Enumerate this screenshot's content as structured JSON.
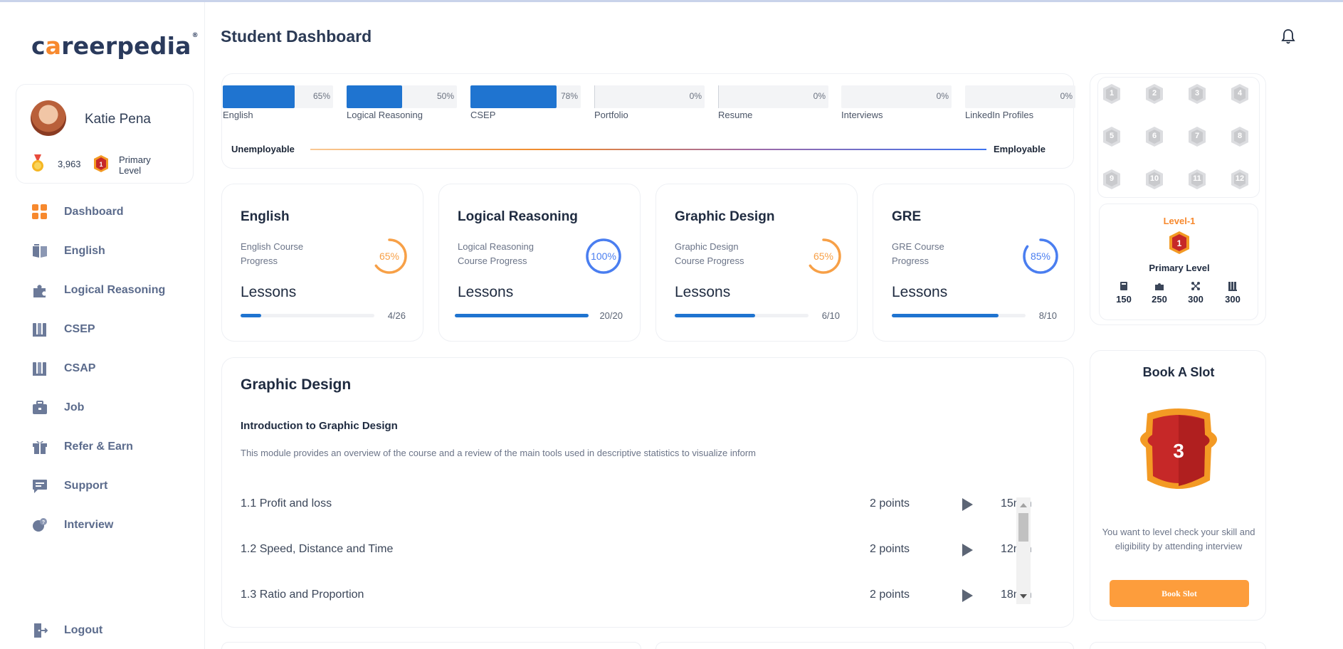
{
  "brand": {
    "logo_pre": "c",
    "logo_o": "a",
    "logo_post": "reerpedia",
    "reg": "®"
  },
  "profile": {
    "name": "Katie Pena",
    "points": "3,963",
    "level_badge": "1",
    "level_label": "Primary Level"
  },
  "nav": {
    "items": [
      {
        "label": "Dashboard",
        "icon": "grid-icon"
      },
      {
        "label": "English",
        "icon": "book-icon"
      },
      {
        "label": "Logical Reasoning",
        "icon": "puzzle-icon"
      },
      {
        "label": "CSEP",
        "icon": "books-icon"
      },
      {
        "label": "CSAP",
        "icon": "books-icon"
      },
      {
        "label": "Job",
        "icon": "briefcase-icon"
      },
      {
        "label": "Refer & Earn",
        "icon": "gift-icon"
      },
      {
        "label": "Support",
        "icon": "chat-icon"
      },
      {
        "label": "Interview",
        "icon": "interview-icon"
      }
    ],
    "logout": "Logout"
  },
  "header": {
    "title": "Student Dashboard"
  },
  "progress": {
    "items": [
      {
        "label": "English",
        "pct_text": "65%",
        "value": 0.65
      },
      {
        "label": "Logical Reasoning",
        "pct_text": "50%",
        "value": 0.5
      },
      {
        "label": "CSEP",
        "pct_text": "78%",
        "value": 0.78
      },
      {
        "label": "Portfolio",
        "pct_text": "0%",
        "value": 0
      },
      {
        "label": "Resume",
        "pct_text": "0%",
        "value": 0
      },
      {
        "label": "Interviews",
        "pct_text": "0%",
        "value": 0
      },
      {
        "label": "LinkedIn Profiles",
        "pct_text": "0%",
        "value": 0
      }
    ],
    "unemployable": "Unemployable",
    "employable": "Employable"
  },
  "courses": [
    {
      "title": "English",
      "subtitle": "English Course Progress",
      "pct_text": "65%",
      "pct": 0.65,
      "ring_color": "#f7a047",
      "lessons_label": "Lessons",
      "done": 4,
      "total": 26,
      "count_text": "4/26"
    },
    {
      "title": "Logical Reasoning",
      "subtitle": "Logical Reasoning Course Progress",
      "pct_text": "100%",
      "pct": 1.0,
      "ring_color": "#4a7ef0",
      "lessons_label": "Lessons",
      "done": 20,
      "total": 20,
      "count_text": "20/20"
    },
    {
      "title": "Graphic Design",
      "subtitle": "Graphic Design Course Progress",
      "pct_text": "65%",
      "pct": 0.65,
      "ring_color": "#f7a047",
      "lessons_label": "Lessons",
      "done": 6,
      "total": 10,
      "count_text": "6/10"
    },
    {
      "title": "GRE",
      "subtitle": "GRE Course Progress",
      "pct_text": "85%",
      "pct": 0.85,
      "ring_color": "#4a7ef0",
      "lessons_label": "Lessons",
      "done": 8,
      "total": 10,
      "count_text": "8/10"
    }
  ],
  "module": {
    "title": "Graphic Design",
    "subtitle": "Introduction to Graphic Design",
    "description": "This module provides an overview of the course and a review of the main tools used in descriptive statistics to visualize inform",
    "lessons": [
      {
        "name": "1.1 Profit and loss",
        "points": "2 points",
        "time": "15min"
      },
      {
        "name": "1.2 Speed, Distance and Time",
        "points": "2 points",
        "time": "12min"
      },
      {
        "name": "1.3 Ratio and Proportion",
        "points": "2 points",
        "time": "18min"
      }
    ]
  },
  "levels": {
    "grid": [
      "1",
      "2",
      "3",
      "4",
      "5",
      "6",
      "7",
      "8",
      "9",
      "10",
      "11",
      "12"
    ],
    "current_name": "Level-1",
    "current_badge": "1",
    "current_sub": "Primary Level",
    "stats": [
      {
        "icon": "book-icon",
        "value": "150"
      },
      {
        "icon": "puzzle-icon",
        "value": "250"
      },
      {
        "icon": "network-icon",
        "value": "300"
      },
      {
        "icon": "books-icon",
        "value": "300"
      }
    ]
  },
  "book_slot": {
    "title": "Book A Slot",
    "badge": "3",
    "text": "You want to level check your skill and eligibility by attending interview",
    "button": "Book Slot"
  },
  "colors": {
    "primary": "#1f74d0",
    "accent": "#f7892e",
    "ring_blue": "#4a7ef0",
    "button": "#fd9d3c"
  }
}
